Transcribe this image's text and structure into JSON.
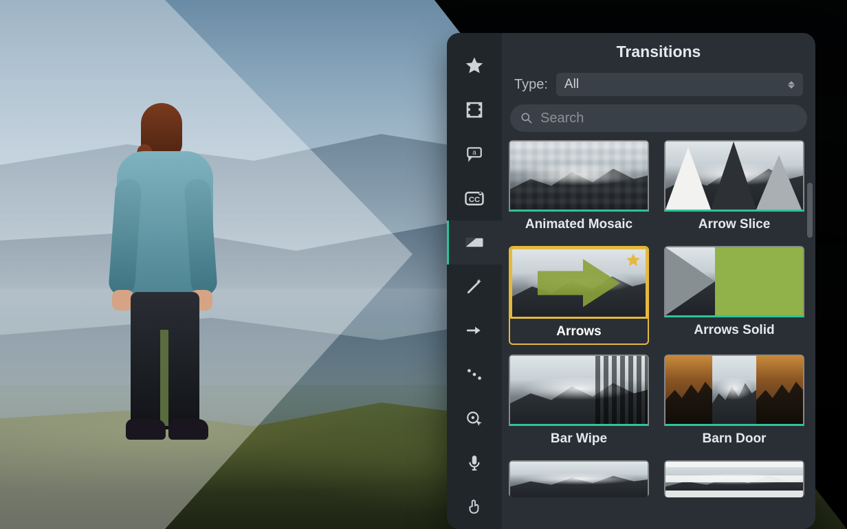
{
  "panel": {
    "title": "Transitions",
    "type_label": "Type:",
    "type_value": "All",
    "search_placeholder": "Search"
  },
  "toolbar": [
    {
      "name": "favorites",
      "icon": "star"
    },
    {
      "name": "media",
      "icon": "filmstrip"
    },
    {
      "name": "annotations",
      "icon": "callout"
    },
    {
      "name": "captions",
      "icon": "cc"
    },
    {
      "name": "transitions",
      "icon": "transition",
      "active": true
    },
    {
      "name": "behaviors",
      "icon": "wand"
    },
    {
      "name": "animations",
      "icon": "motion-arrow"
    },
    {
      "name": "audio-fx",
      "icon": "audio-points"
    },
    {
      "name": "cursor-fx",
      "icon": "cursor-fx"
    },
    {
      "name": "voice",
      "icon": "microphone"
    },
    {
      "name": "interactive",
      "icon": "hand-tap"
    }
  ],
  "transitions": [
    {
      "name": "Animated Mosaic",
      "thumb": "mosaic",
      "favorite": false,
      "selected": false
    },
    {
      "name": "Arrow Slice",
      "thumb": "arrowslice",
      "favorite": false,
      "selected": false
    },
    {
      "name": "Arrows",
      "thumb": "arrows",
      "favorite": true,
      "selected": true
    },
    {
      "name": "Arrows Solid",
      "thumb": "arrowsolid",
      "favorite": false,
      "selected": false
    },
    {
      "name": "Bar Wipe",
      "thumb": "barwipe",
      "favorite": false,
      "selected": false
    },
    {
      "name": "Barn Door",
      "thumb": "barndoor",
      "favorite": false,
      "selected": false
    },
    {
      "name": "",
      "thumb": "plain",
      "favorite": false,
      "selected": false,
      "peek": true
    },
    {
      "name": "",
      "thumb": "stripes",
      "favorite": false,
      "selected": false,
      "peek": true
    }
  ],
  "colors": {
    "accent": "#2cc597",
    "highlight": "#e5b93e"
  }
}
